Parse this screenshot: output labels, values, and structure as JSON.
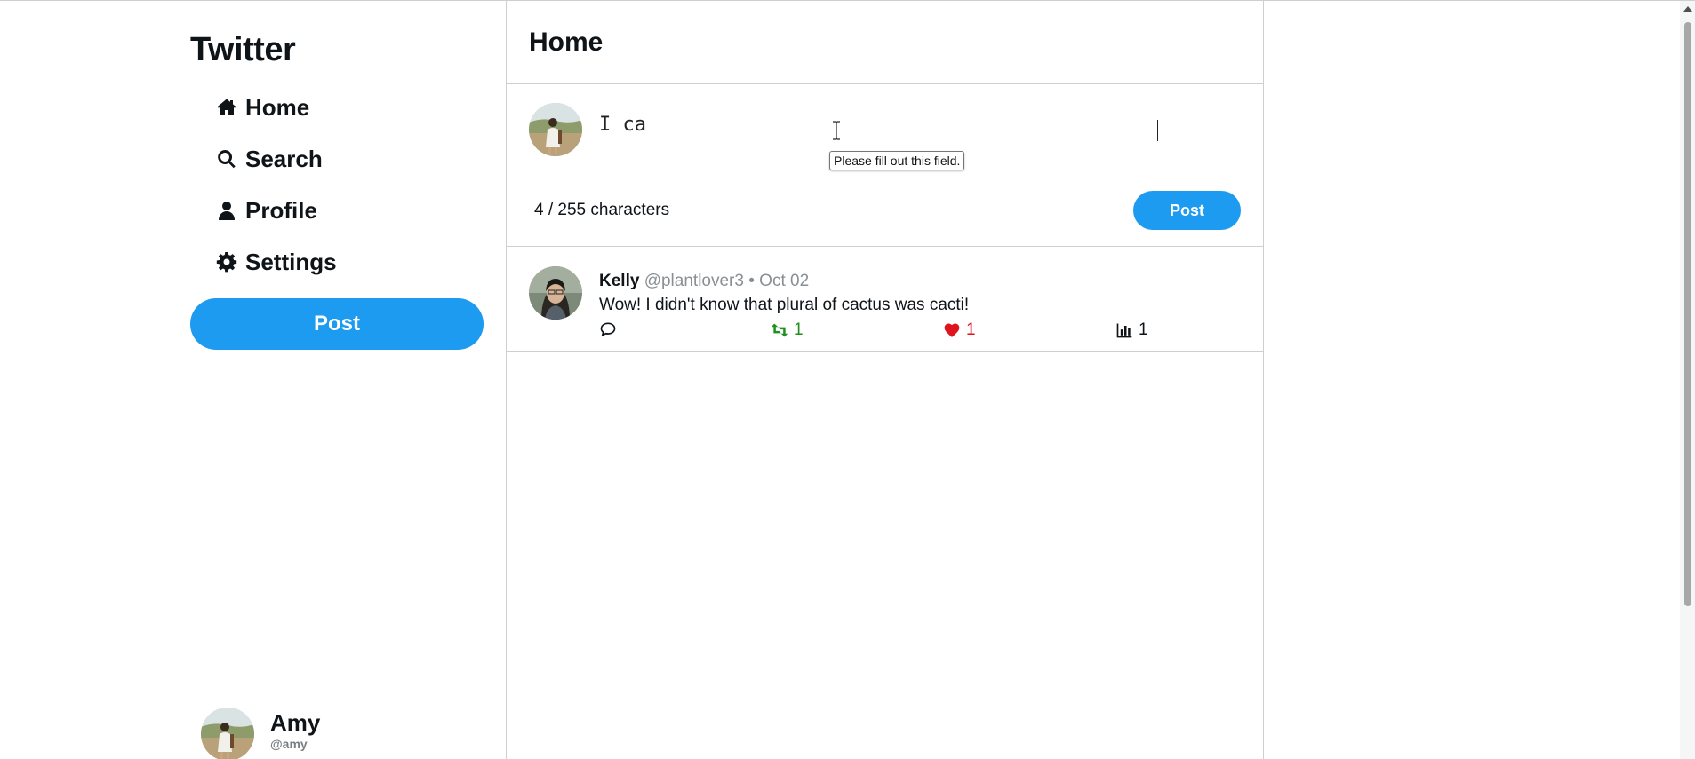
{
  "brand": "Twitter",
  "nav": {
    "home": "Home",
    "search": "Search",
    "profile": "Profile",
    "settings": "Settings"
  },
  "sidebar": {
    "post_label": "Post"
  },
  "account": {
    "name": "Amy",
    "handle": "@amy"
  },
  "main": {
    "title": "Home"
  },
  "composer": {
    "value": "I ca",
    "char_count": "4 / 255 characters",
    "post_label": "Post",
    "validation_message": "Please fill out this field."
  },
  "tweets": [
    {
      "author": "Kelly",
      "handle": "@plantlover3",
      "separator": "•",
      "date": "Oct 02",
      "text": "Wow! I didn't know that plural of cactus was cacti!",
      "retweets": "1",
      "likes": "1",
      "views": "1"
    }
  ],
  "colors": {
    "accent": "#1d9bf0",
    "retweet": "#1f8f1f",
    "like": "#e0141e",
    "muted": "#8a8f94"
  },
  "icons": [
    "home-icon",
    "search-icon",
    "user-icon",
    "gear-icon",
    "reply-icon",
    "retweet-icon",
    "heart-icon",
    "bar-chart-icon"
  ]
}
